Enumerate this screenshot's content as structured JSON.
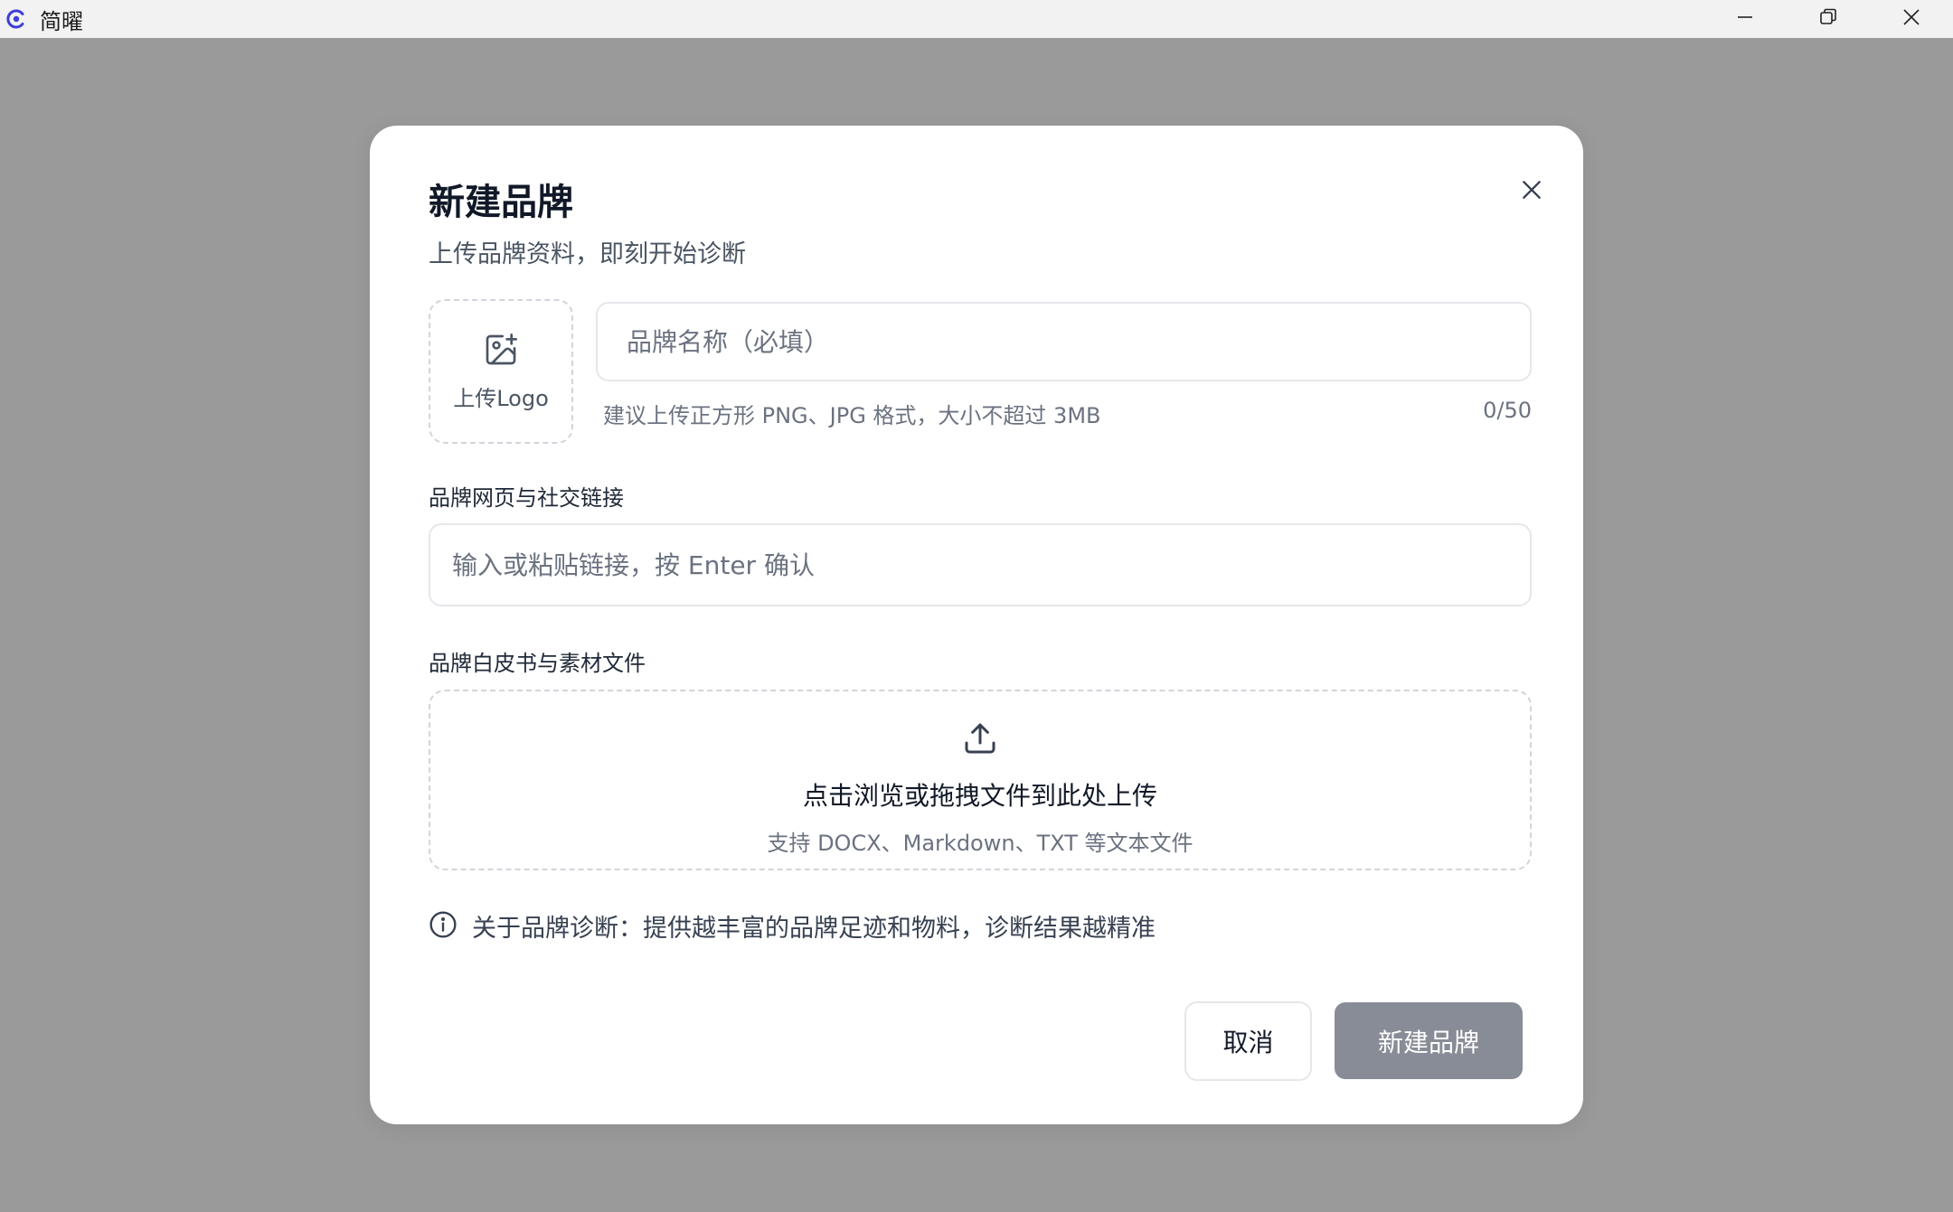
{
  "app": {
    "title": "简曜",
    "logo_icon": "app-logo-icon"
  },
  "window_controls": {
    "minimize_icon": "minimize-icon",
    "restore_icon": "restore-icon",
    "close_icon": "close-icon"
  },
  "modal": {
    "title": "新建品牌",
    "subtitle": "上传品牌资料，即刻开始诊断",
    "close_icon": "close-icon",
    "logo_upload": {
      "icon": "image-plus-icon",
      "label": "上传Logo"
    },
    "brand_name": {
      "placeholder": "品牌名称（必填）",
      "value": "",
      "hint": "建议上传正方形 PNG、JPG 格式，大小不超过 3MB",
      "count": "0/50"
    },
    "links": {
      "label": "品牌网页与社交链接",
      "placeholder": "输入或粘贴链接，按 Enter 确认",
      "value": ""
    },
    "files": {
      "label": "品牌白皮书与素材文件",
      "icon": "upload-icon",
      "title": "点击浏览或拖拽文件到此处上传",
      "subtitle": "支持 DOCX、Markdown、TXT 等文本文件"
    },
    "info": {
      "icon": "info-icon",
      "text": "关于品牌诊断：提供越丰富的品牌足迹和物料，诊断结果越精准"
    },
    "buttons": {
      "cancel": "取消",
      "submit": "新建品牌"
    }
  },
  "colors": {
    "backdrop": "#9a9a9a",
    "titlebar": "#f2f2f2",
    "modal_bg": "#ffffff",
    "submit_bg": "#888c96",
    "logo_accent": "#3b3fd6"
  }
}
